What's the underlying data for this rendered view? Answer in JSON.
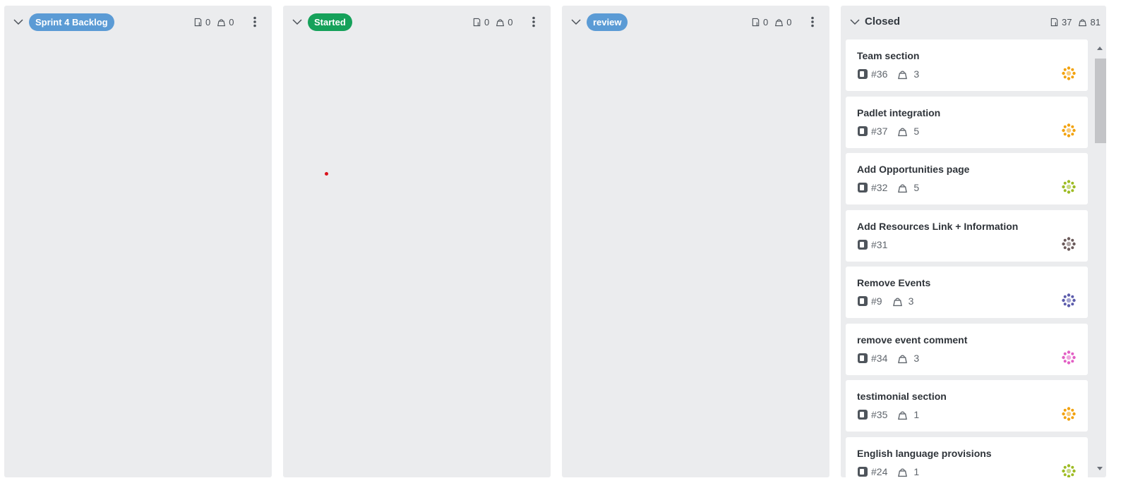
{
  "columns": [
    {
      "title": "Sprint 4 Backlog",
      "pill_color": "#5b9bd5",
      "issue_count": "0",
      "weight_count": "0"
    },
    {
      "title": "Started",
      "pill_color": "#15a15a",
      "issue_count": "0",
      "weight_count": "0"
    },
    {
      "title": "review",
      "pill_color": "#5b9bd5",
      "issue_count": "0",
      "weight_count": "0"
    },
    {
      "title": "Closed",
      "issue_count": "37",
      "weight_count": "81",
      "cards": [
        {
          "title": "Team section",
          "number": "#36",
          "weight": "3",
          "avatar_color": "#f2a20e"
        },
        {
          "title": "Padlet integration",
          "number": "#37",
          "weight": "5",
          "avatar_color": "#f2a20e"
        },
        {
          "title": "Add Opportunities page",
          "number": "#32",
          "weight": "5",
          "avatar_color": "#9dbb23"
        },
        {
          "title": "Add Resources Link + Information",
          "number": "#31",
          "weight": "",
          "avatar_color": "#6b5a5a"
        },
        {
          "title": "Remove Events",
          "number": "#9",
          "weight": "3",
          "avatar_color": "#5b5bab"
        },
        {
          "title": "remove event comment",
          "number": "#34",
          "weight": "3",
          "avatar_color": "#e25fc4"
        },
        {
          "title": "testimonial section",
          "number": "#35",
          "weight": "1",
          "avatar_color": "#f2a20e"
        },
        {
          "title": "English language provisions",
          "number": "#24",
          "weight": "1",
          "avatar_color": "#9dbb23"
        }
      ]
    }
  ],
  "icons": {
    "collapse": "chevron-down-icon",
    "issue": "issue-icon",
    "weight": "weight-icon",
    "menu": "kebab-menu-icon"
  }
}
